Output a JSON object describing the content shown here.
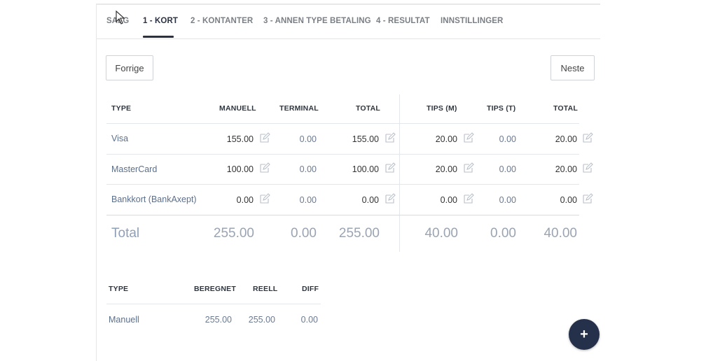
{
  "tabs": [
    {
      "label": "SALG"
    },
    {
      "label": "1 - KORT"
    },
    {
      "label": "2 - KONTANTER"
    },
    {
      "label": "3 - ANNEN TYPE BETALING"
    },
    {
      "label": "4 - RESULTAT"
    },
    {
      "label": "INNSTILLINGER"
    }
  ],
  "active_tab": "1 - KORT",
  "buttons": {
    "prev": "Forrige",
    "next": "Neste"
  },
  "card_table": {
    "headers": {
      "type": "TYPE",
      "manual": "MANUELL",
      "terminal": "TERMINAL",
      "total": "TOTAL",
      "tips_m": "TIPS (M)",
      "tips_t": "TIPS (T)",
      "tips_total": "TOTAL"
    },
    "rows": [
      {
        "type": "Visa",
        "manual": "155.00",
        "terminal": "0.00",
        "total": "155.00",
        "tips_m": "20.00",
        "tips_t": "0.00",
        "tips_total": "20.00"
      },
      {
        "type": "MasterCard",
        "manual": "100.00",
        "terminal": "0.00",
        "total": "100.00",
        "tips_m": "20.00",
        "tips_t": "0.00",
        "tips_total": "20.00"
      },
      {
        "type": "Bankkort (BankAxept)",
        "manual": "0.00",
        "terminal": "0.00",
        "total": "0.00",
        "tips_m": "0.00",
        "tips_t": "0.00",
        "tips_total": "0.00"
      }
    ],
    "totals": {
      "label": "Total",
      "manual": "255.00",
      "terminal": "0.00",
      "total": "255.00",
      "tips_m": "40.00",
      "tips_t": "0.00",
      "tips_total": "40.00"
    }
  },
  "summary_table": {
    "headers": {
      "type": "TYPE",
      "computed": "BEREGNET",
      "actual": "REELL",
      "diff": "DIFF"
    },
    "rows": [
      {
        "type": "Manuell",
        "computed": "255.00",
        "actual": "255.00",
        "diff": "0.00"
      }
    ]
  },
  "fab": {
    "label": "+"
  },
  "colors": {
    "accent": "#25314a",
    "muted_text": "#5c6f8a"
  }
}
